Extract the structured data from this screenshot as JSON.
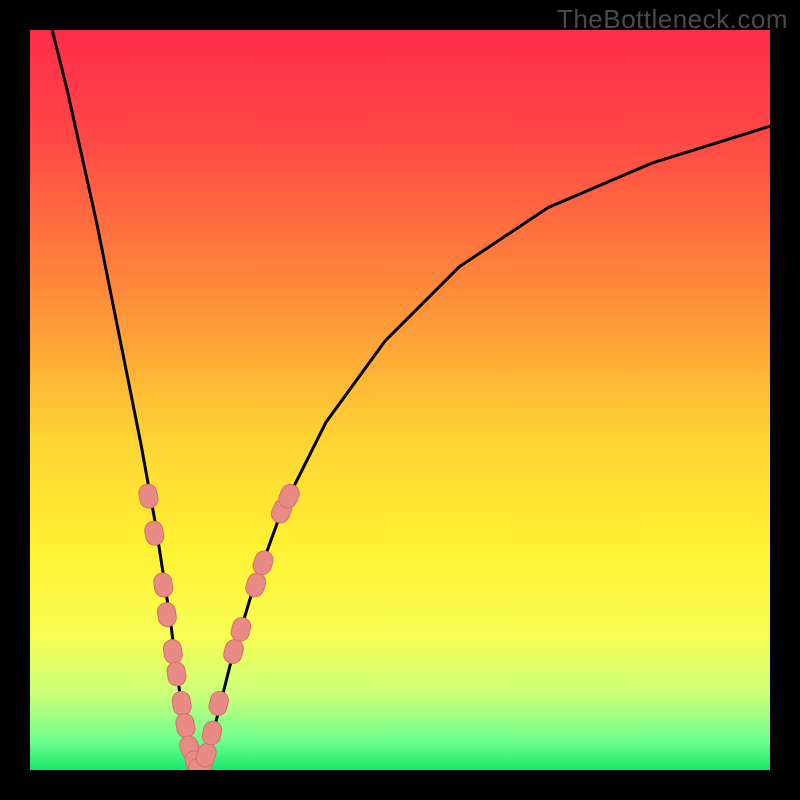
{
  "watermark": "TheBottleneck.com",
  "colors": {
    "frame": "#000000",
    "curve": "#000000",
    "marker_fill": "#e98b85",
    "marker_stroke": "#d46e6e",
    "gradient_stops": [
      {
        "offset": 0.0,
        "color": "#ff2c4b"
      },
      {
        "offset": 0.15,
        "color": "#ff4946"
      },
      {
        "offset": 0.35,
        "color": "#ff8a3a"
      },
      {
        "offset": 0.55,
        "color": "#ffd334"
      },
      {
        "offset": 0.7,
        "color": "#fff232"
      },
      {
        "offset": 0.82,
        "color": "#f8ff55"
      },
      {
        "offset": 0.9,
        "color": "#c7ff7a"
      },
      {
        "offset": 0.96,
        "color": "#6fff8e"
      },
      {
        "offset": 1.0,
        "color": "#17e86a"
      }
    ]
  },
  "chart_data": {
    "type": "line",
    "title": "",
    "xlabel": "",
    "ylabel": "",
    "xlim": [
      0,
      100
    ],
    "ylim": [
      0,
      100
    ],
    "comment": "Approximate V-shaped bottleneck curve; values estimated from pixel position. y≈0 at the notch near x≈22.",
    "series": [
      {
        "name": "bottleneck-curve",
        "x": [
          3,
          5,
          7,
          9,
          11,
          13,
          15,
          17,
          19,
          20,
          21,
          22,
          23,
          24,
          25,
          27,
          30,
          34,
          40,
          48,
          58,
          70,
          84,
          100
        ],
        "y": [
          100,
          92,
          83,
          74,
          64,
          54,
          44,
          33,
          20,
          12,
          6,
          1,
          0.5,
          2,
          6,
          14,
          24,
          35,
          47,
          58,
          68,
          76,
          82,
          87
        ]
      }
    ],
    "markers": {
      "name": "highlighted-points",
      "comment": "Pink capsule markers clustered near the notch on both branches.",
      "points": [
        {
          "x": 16.0,
          "y": 37
        },
        {
          "x": 16.8,
          "y": 32
        },
        {
          "x": 18.0,
          "y": 25
        },
        {
          "x": 18.5,
          "y": 21
        },
        {
          "x": 19.3,
          "y": 16
        },
        {
          "x": 19.8,
          "y": 13
        },
        {
          "x": 20.5,
          "y": 9
        },
        {
          "x": 21.0,
          "y": 6
        },
        {
          "x": 21.6,
          "y": 3
        },
        {
          "x": 22.3,
          "y": 1
        },
        {
          "x": 23.0,
          "y": 0.5
        },
        {
          "x": 23.8,
          "y": 2
        },
        {
          "x": 24.6,
          "y": 5
        },
        {
          "x": 25.5,
          "y": 9
        },
        {
          "x": 27.5,
          "y": 16
        },
        {
          "x": 28.5,
          "y": 19
        },
        {
          "x": 30.5,
          "y": 25
        },
        {
          "x": 31.5,
          "y": 28
        },
        {
          "x": 34.0,
          "y": 35
        },
        {
          "x": 35.0,
          "y": 37
        }
      ]
    }
  }
}
